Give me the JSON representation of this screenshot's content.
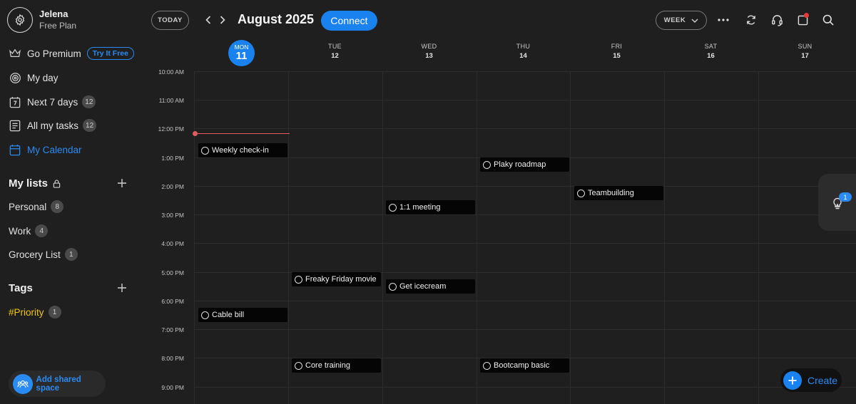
{
  "profile": {
    "name": "Jelena",
    "plan": "Free Plan",
    "icon": "gear-icon"
  },
  "nav": {
    "premium": {
      "label": "Go Premium",
      "cta": "Try It Free",
      "icon": "crown-icon"
    },
    "my_day": {
      "label": "My day",
      "icon": "target-icon"
    },
    "next7": {
      "label": "Next 7 days",
      "count": "12",
      "icon": "calendar-7-icon"
    },
    "all_tasks": {
      "label": "All my tasks",
      "count": "12",
      "icon": "list-icon"
    },
    "calendar": {
      "label": "My Calendar",
      "icon": "calendar-icon"
    }
  },
  "lists": {
    "title": "My lists",
    "items": [
      {
        "label": "Personal",
        "count": "8"
      },
      {
        "label": "Work",
        "count": "4"
      },
      {
        "label": "Grocery List",
        "count": "1"
      }
    ]
  },
  "tags": {
    "title": "Tags",
    "items": [
      {
        "label": "#Priority",
        "count": "1"
      }
    ]
  },
  "shared_space": {
    "label": "Add shared space"
  },
  "toolbar": {
    "today": "TODAY",
    "month": "August 2025",
    "connect": "Connect",
    "view": "WEEK"
  },
  "days": [
    {
      "name": "MON",
      "num": "11",
      "today": true
    },
    {
      "name": "TUE",
      "num": "12"
    },
    {
      "name": "WED",
      "num": "13"
    },
    {
      "name": "THU",
      "num": "14"
    },
    {
      "name": "FRI",
      "num": "15"
    },
    {
      "name": "SAT",
      "num": "16"
    },
    {
      "name": "SUN",
      "num": "17"
    }
  ],
  "times": [
    "10:00 AM",
    "11:00 AM",
    "12:00 PM",
    "1:00 PM",
    "2:00 PM",
    "3:00 PM",
    "4:00 PM",
    "5:00 PM",
    "6:00 PM",
    "7:00 PM",
    "8:00 PM",
    "9:00 PM"
  ],
  "events": [
    {
      "title": "Weekly check-in",
      "day": "MON",
      "time": "12:30 PM"
    },
    {
      "title": "Plaky roadmap",
      "day": "THU",
      "time": "1:00 PM"
    },
    {
      "title": "Teambuilding",
      "day": "FRI",
      "time": "2:00 PM"
    },
    {
      "title": "1:1 meeting",
      "day": "WED",
      "time": "2:30 PM"
    },
    {
      "title": "Freaky Friday movie",
      "day": "TUE",
      "time": "5:00 PM"
    },
    {
      "title": "Get icecream",
      "day": "WED",
      "time": "5:15 PM"
    },
    {
      "title": "Cable bill",
      "day": "MON",
      "time": "6:15 PM"
    },
    {
      "title": "Core training",
      "day": "TUE",
      "time": "8:00 PM"
    },
    {
      "title": "Bootcamp basic",
      "day": "THU",
      "time": "8:00 PM"
    }
  ],
  "suggestions": {
    "count": "1",
    "icon": "lightbulb-icon"
  },
  "create": {
    "label": "Create"
  },
  "colors": {
    "accent": "#1a82ee",
    "tag": "#f0c419",
    "now_line": "#e05c5c",
    "background": "#1f1f1f"
  }
}
